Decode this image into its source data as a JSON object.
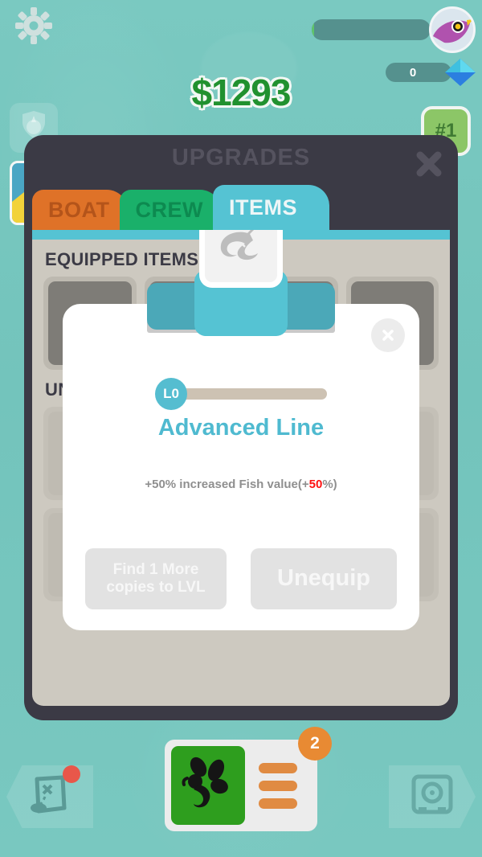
{
  "hud": {
    "money": "$1293",
    "gems": "0",
    "rank": "#1",
    "xp_percent": 2,
    "gear_icon": "gear-icon",
    "avatar_icon": "bird-avatar-icon",
    "gem_icon": "diamond-icon",
    "left_badge_icon": "crew-shield-icon",
    "accent_green": "#21912f",
    "accent_teal": "#78c7bf"
  },
  "panel": {
    "title": "UPGRADES",
    "close_icon": "close-icon",
    "tabs": [
      {
        "label": "BOAT",
        "name": "tab-boat",
        "active": false
      },
      {
        "label": "CREW",
        "name": "tab-crew",
        "active": false
      },
      {
        "label": "ITEMS",
        "name": "tab-items",
        "active": true
      }
    ],
    "sections": [
      {
        "heading": "EQUIPPED ITEMS"
      },
      {
        "heading": "UNEQUIPPED ITEMS"
      }
    ]
  },
  "modal": {
    "close_icon": "close-icon",
    "item_icon": "fishing-line-icon",
    "level_badge": "L0",
    "level_progress_percent": 0,
    "name": "Advanced Line",
    "description_prefix": "+50% increased Fish value(+",
    "description_highlight": "50",
    "description_suffix": "%)",
    "buttons": {
      "find_more": "Find 1 More\ncopies to LVL",
      "find_more_line1": "Find 1 More",
      "find_more_line2": "copies to LVL",
      "unequip": "Unequip"
    },
    "name_color": "#4fbad0",
    "highlight_color": "#ff1111"
  },
  "bottom": {
    "map_icon": "treasure-map-icon",
    "map_notification": true,
    "safe_icon": "safe-vault-icon",
    "fish_icon": "fish-hook-icon",
    "menu_icon": "menu-lines-icon",
    "badge_count": "2"
  }
}
